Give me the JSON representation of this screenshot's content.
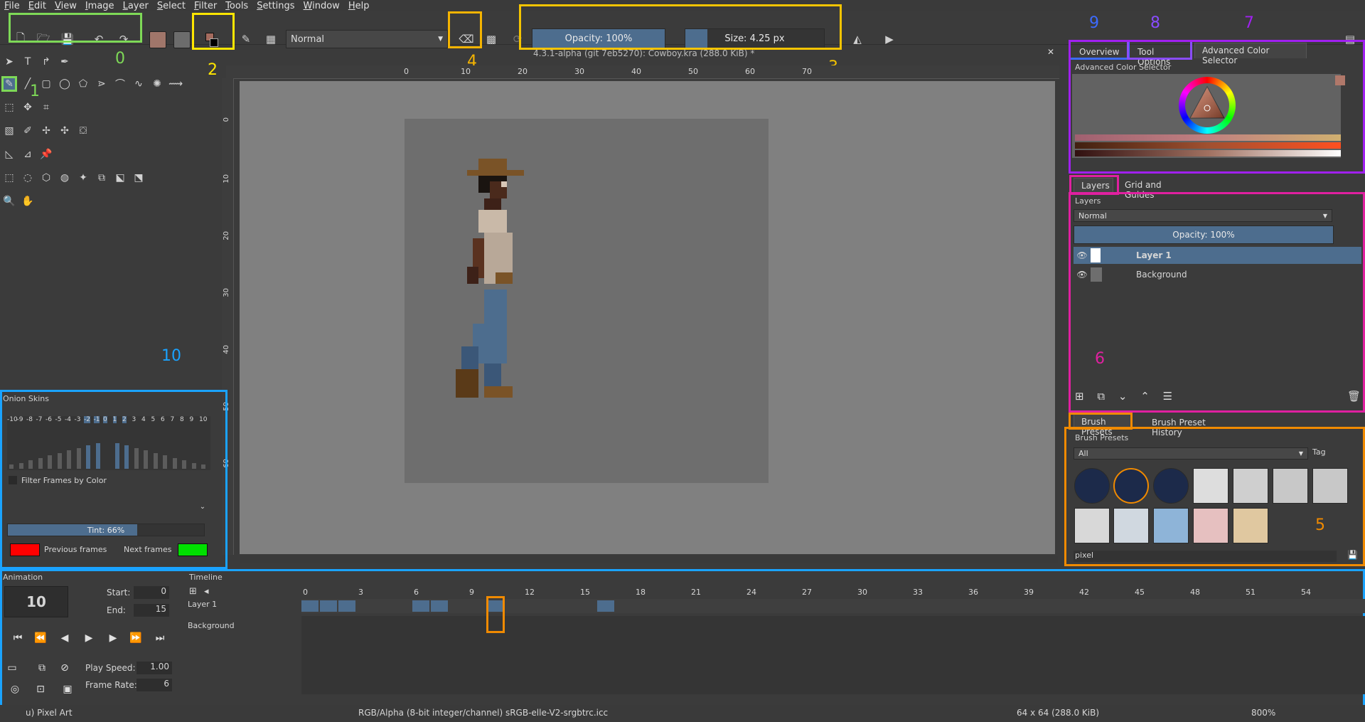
{
  "menu": [
    "File",
    "Edit",
    "View",
    "Image",
    "Layer",
    "Select",
    "Filter",
    "Tools",
    "Settings",
    "Window",
    "Help"
  ],
  "toolbar": {
    "blend_mode": "Normal",
    "opacity_label": "Opacity: 100%",
    "opacity_value": 100,
    "size_label": "Size: 4.25 px"
  },
  "document": {
    "title": "4.3.1-alpha (git 7eb5270): Cowboy.kra (288.0 KiB) *",
    "ruler_h_ticks": [
      "0",
      "10",
      "20",
      "30",
      "40",
      "50",
      "60",
      "70"
    ],
    "ruler_v_ticks": [
      "0",
      "10",
      "20",
      "30",
      "40",
      "50",
      "60"
    ]
  },
  "annotations": {
    "n0": "0",
    "n1": "1",
    "n2": "2",
    "n3": "3",
    "n4": "4",
    "n5": "5",
    "n6": "6",
    "n7": "7",
    "n8": "8",
    "n9": "9",
    "n10": "10"
  },
  "docker_tabs": {
    "overview": "Overview",
    "tool_options": "Tool Options",
    "advanced_color_selector": "Advanced Color Selector"
  },
  "color_selector": {
    "title": "Advanced Color Selector"
  },
  "layers_panel": {
    "tab_layers": "Layers",
    "tab_grid": "Grid and Guides",
    "title": "Layers",
    "blend_mode": "Normal",
    "opacity_label": "Opacity:  100%",
    "layers": [
      "Layer 1",
      "Background"
    ]
  },
  "brush_panel": {
    "tab_presets": "Brush Presets",
    "tab_history": "Brush Preset History",
    "title": "Brush Presets",
    "filter": "All",
    "tag_label": "Tag",
    "search": "pixel"
  },
  "onion": {
    "title": "Onion Skins",
    "frame_labels": [
      "-10",
      "-9",
      "-8",
      "-7",
      "-6",
      "-5",
      "-4",
      "-3",
      "-2",
      "-1",
      "0",
      "1",
      "2",
      "3",
      "4",
      "5",
      "6",
      "7",
      "8",
      "9",
      "10"
    ],
    "filter_label": "Filter Frames by Color",
    "tint_label": "Tint: 66%",
    "tint_value": 66,
    "previous_label": "Previous frames",
    "next_label": "Next frames",
    "previous_color": "#ff0000",
    "next_color": "#00e000"
  },
  "animation": {
    "title": "Animation",
    "current_frame": "10",
    "start_label": "Start:",
    "start_value": "0",
    "end_label": "End:",
    "end_value": "15",
    "play_speed_label": "Play Speed:",
    "play_speed_value": "1.00",
    "frame_rate_label": "Frame Rate:",
    "frame_rate_value": "6"
  },
  "timeline": {
    "title": "Timeline",
    "ticks": [
      "0",
      "3",
      "6",
      "9",
      "12",
      "15",
      "18",
      "21",
      "24",
      "27",
      "30",
      "33",
      "36",
      "39",
      "42",
      "45",
      "48",
      "51",
      "54"
    ],
    "layers": [
      "Layer 1",
      "Background"
    ]
  },
  "status": {
    "workspace": "u) Pixel Art",
    "colorspace": "RGB/Alpha (8-bit integer/channel)  sRGB-elle-V2-srgbtrc.icc",
    "dimensions": "64 x 64 (288.0 KiB)",
    "zoom": "800%"
  },
  "colors": {
    "green": "#7ed957",
    "yellow": "#ffe600",
    "gold": "#f5c400",
    "orange": "#f08a00",
    "magenta": "#e020a0",
    "purple": "#a020f0",
    "violet": "#8a4cff",
    "blue": "#3d6bff",
    "cyan": "#1aa3ff",
    "accent": "#4d6d8e"
  }
}
